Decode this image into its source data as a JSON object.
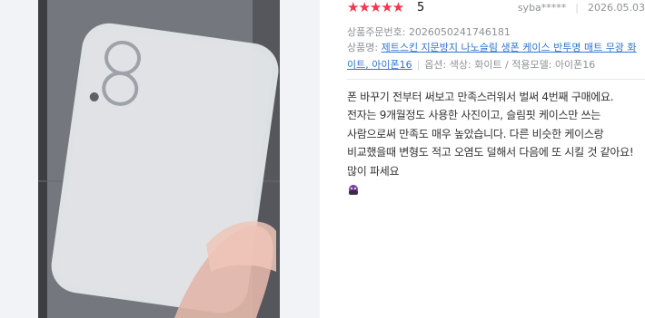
{
  "review": {
    "stars": "★★★★★",
    "score": "5",
    "user": "syba*****",
    "date": "2026.05.03",
    "order_label": "상품주문번호:",
    "order_number": "2026050241746181",
    "product_label": "상품명:",
    "product_name": "제트스킨 지문방지 나노슬림 생폰 케이스 반투명 매트 무광 화이트, 아이폰16",
    "options": "옵션: 색상: 화이트 / 적용모델: 아이폰16",
    "body": "폰 바꾸기 전부터 써보고 만족스러워서 벌써 4번째 구매에요. 전자는 9개월정도 사용한 사진이고, 슬림핏 케이스만 쓰는 사람으로써 만족도 매우 높았습니다. 다른 비슷한 케이스랑 비교했을때 변형도 적고 오염도 덜해서 다음에 또 시킬 것 같아요! 많이 파세요",
    "emoji_icon": "mascot-emoji-icon"
  },
  "colors": {
    "star": "#f7344b",
    "link": "#2f75d6",
    "meta": "#8e9196",
    "left_pane_bg": "#f2f3f6"
  }
}
